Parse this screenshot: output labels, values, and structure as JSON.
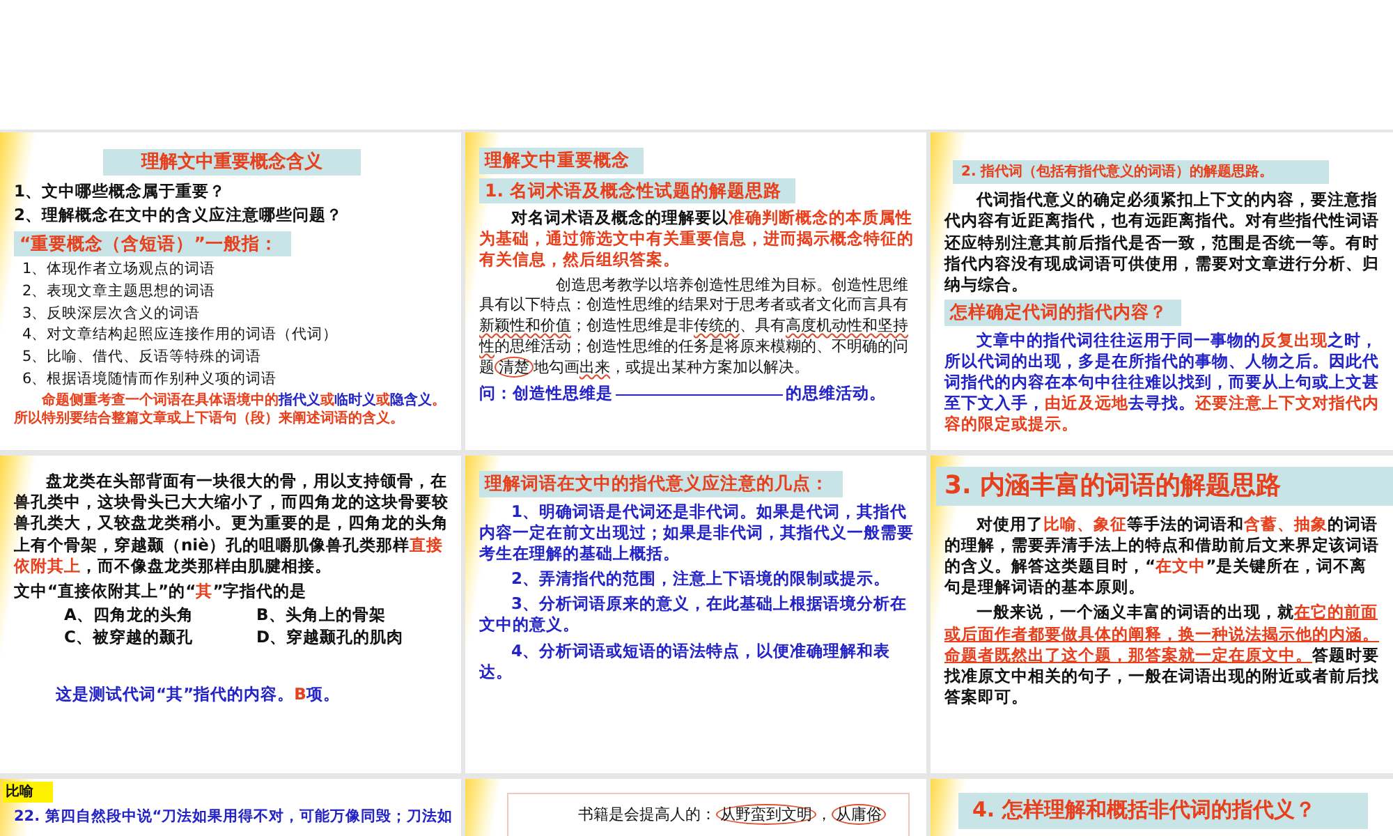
{
  "slides": [
    {
      "blocks": [
        {
          "kind": "title",
          "runs": [
            {
              "kind": "red",
              "text": "理解文中重要概念含义"
            }
          ]
        },
        {
          "kind": "line",
          "runs": [
            {
              "kind": "plain",
              "text": "1、文中哪些概念属于重要？"
            }
          ]
        },
        {
          "kind": "line",
          "runs": [
            {
              "kind": "plain",
              "text": "2、理解概念在文中的含义应注意哪些问题？"
            }
          ]
        },
        {
          "kind": "band",
          "runs": [
            {
              "kind": "red",
              "text": "“重要概念（含短语）”一般指："
            }
          ]
        },
        {
          "kind": "subline",
          "runs": [
            {
              "kind": "plain",
              "text": "1、体现作者立场观点的词语"
            }
          ]
        },
        {
          "kind": "subline",
          "runs": [
            {
              "kind": "plain",
              "text": "2、表现文章主题思想的词语"
            }
          ]
        },
        {
          "kind": "subline",
          "runs": [
            {
              "kind": "plain",
              "text": "3、反映深层次含义的词语"
            }
          ]
        },
        {
          "kind": "subline",
          "runs": [
            {
              "kind": "plain",
              "text": "4、对文章结构起照应连接作用的词语（代词）"
            }
          ]
        },
        {
          "kind": "subline",
          "runs": [
            {
              "kind": "plain",
              "text": "5、比喻、借代、反语等特殊的词语"
            }
          ]
        },
        {
          "kind": "subline",
          "runs": [
            {
              "kind": "plain",
              "text": "6、根据语境随情而作别种义项的词语"
            }
          ]
        },
        {
          "kind": "note",
          "runs": [
            {
              "kind": "red",
              "text": "命题侧重考查一个词语在具体语境中的"
            },
            {
              "kind": "blue",
              "text": "指代义"
            },
            {
              "kind": "red",
              "text": "或"
            },
            {
              "kind": "blue",
              "text": "临时义"
            },
            {
              "kind": "red",
              "text": "或"
            },
            {
              "kind": "blue",
              "text": "隐含义"
            },
            {
              "kind": "red",
              "text": "。所以特别要结合整篇文章或上下语句（段）来阐述词语的含义。"
            }
          ]
        }
      ]
    },
    {
      "blocks": [
        {
          "kind": "band",
          "runs": [
            {
              "kind": "red",
              "text": "理解文中重要概念"
            }
          ]
        },
        {
          "kind": "band",
          "runs": [
            {
              "kind": "red",
              "text": "1. 名词术语及概念性试题的解题思路"
            }
          ]
        },
        {
          "kind": "para",
          "runs": [
            {
              "kind": "plain",
              "text": "对名词术语及概念的理解要以"
            },
            {
              "kind": "red",
              "text": "准确判断概念的本质属性为基础，通过筛选文中有关重要信息，进而揭示概念特征的有关信息，然后组织答案。"
            }
          ]
        },
        {
          "kind": "quote",
          "runs": [
            {
              "kind": "plain",
              "text": "创造思考教学以培养创造性思维为目标。创造性思维具有以下特点：创造性思维的结果对于思考者或者文化而言具有"
            },
            {
              "kind": "marked",
              "text": "新颖性和价值"
            },
            {
              "kind": "plain",
              "text": "；创造性思维是非"
            },
            {
              "kind": "marked",
              "text": "传统的"
            },
            {
              "kind": "plain",
              "text": "、具有"
            },
            {
              "kind": "marked",
              "text": "高度机动性和坚持性"
            },
            {
              "kind": "plain",
              "text": "的思维活动；创造性思维的任务是将原来模糊的、不明确的问题"
            },
            {
              "kind": "circled",
              "text": "清楚"
            },
            {
              "kind": "plain",
              "text": "地勾画"
            },
            {
              "kind": "marked",
              "text": "出来"
            },
            {
              "kind": "plain",
              "text": "，或提出某种方案加以解决。"
            }
          ]
        },
        {
          "kind": "line",
          "runs": [
            {
              "kind": "blue",
              "text": "问：创造性思维是"
            },
            {
              "kind": "blank"
            },
            {
              "kind": "blue",
              "text": "的思维活动。"
            }
          ]
        }
      ]
    },
    {
      "blocks": [
        {
          "kind": "smallband",
          "runs": [
            {
              "kind": "red",
              "text": "2. 指代词（包括有指代意义的词语）的解题思路。"
            }
          ]
        },
        {
          "kind": "para",
          "runs": [
            {
              "kind": "plain",
              "text": "代词指代意义的确定必须紧扣上下文的内容，要注意指代内容有近距离指代，也有远距离指代。对有些指代性词语还应特别注意其前后指代是否一致，范围是否统一等。有时指代内容没有现成词语可供使用，需要对文章进行分析、归纳与综合。"
            }
          ]
        },
        {
          "kind": "band",
          "runs": [
            {
              "kind": "red",
              "text": "怎样确定代词的指代内容？"
            }
          ]
        },
        {
          "kind": "para",
          "runs": [
            {
              "kind": "blue",
              "text": "文章中的指代词往往运用于同一事物的"
            },
            {
              "kind": "red",
              "text": "反复出现"
            },
            {
              "kind": "blue",
              "text": "之时，所以代词的出现，多是在所指代的事物、人物之后。因此代词指代的内容在本句中往往难以找到，而要从上句或上文甚至下文入手，"
            },
            {
              "kind": "red",
              "text": "由近及远地"
            },
            {
              "kind": "blue",
              "text": "去寻找。"
            },
            {
              "kind": "red",
              "text": "还要注意上下文对指代内容的限定或提示。"
            }
          ]
        }
      ]
    },
    {
      "blocks": [
        {
          "kind": "para",
          "runs": [
            {
              "kind": "plain",
              "text": "盘龙类在头部背面有一块很大的骨，用以支持颌骨，在兽孔类中，这块骨头已大大缩小了，而四角龙的这块骨要较兽孔类大，又较盘龙类稍小。更为重要的是，四角龙的头角上有个骨架，穿越颞（niè）孔的咀嚼肌像兽孔类那样"
            },
            {
              "kind": "red",
              "text": "直接依附其上"
            },
            {
              "kind": "plain",
              "text": "，而不像盘龙类那样由肌腱相接。"
            }
          ]
        },
        {
          "kind": "line",
          "runs": [
            {
              "kind": "plain",
              "text": "文中“直接依附其上”的“"
            },
            {
              "kind": "red",
              "text": "其"
            },
            {
              "kind": "plain",
              "text": "”字指代的是"
            }
          ]
        },
        {
          "kind": "options",
          "options": [
            "A、四角龙的头角",
            "B、头角上的骨架"
          ]
        },
        {
          "kind": "options",
          "options": [
            "C、被穿越的颞孔",
            "D、穿越颞孔的肌肉"
          ]
        },
        {
          "kind": "answer",
          "runs": [
            {
              "kind": "blue",
              "text": "这是测试代词“其”指代的内容。"
            },
            {
              "kind": "red",
              "text": "B"
            },
            {
              "kind": "blue",
              "text": "项。"
            }
          ]
        }
      ]
    },
    {
      "blocks": [
        {
          "kind": "band",
          "runs": [
            {
              "kind": "red",
              "text": "理解词语在文中的指代意义应注意的几点："
            }
          ]
        },
        {
          "kind": "para",
          "runs": [
            {
              "kind": "blue",
              "text": "1、明确词语是代词还是非代词。如果是代词，其指代内容一定在前文出现过；如果是非代词，其指代义一般需要考生在理解的基础上概括。"
            }
          ]
        },
        {
          "kind": "para",
          "runs": [
            {
              "kind": "blue",
              "text": "2、弄清指代的范围，注意上下语境的限制或提示。"
            }
          ]
        },
        {
          "kind": "para",
          "runs": [
            {
              "kind": "blue",
              "text": "3、分析词语原来的意义，在此基础上根据语境分析在文中的意义。"
            }
          ]
        },
        {
          "kind": "para",
          "runs": [
            {
              "kind": "blue",
              "text": "4、分析词语或短语的语法特点，以便准确理解和表达。"
            }
          ]
        }
      ]
    },
    {
      "blocks": [
        {
          "kind": "bigband",
          "runs": [
            {
              "kind": "red",
              "text": "3. 内涵丰富的词语的解题思路"
            }
          ]
        },
        {
          "kind": "para",
          "runs": [
            {
              "kind": "plain",
              "text": "对使用了"
            },
            {
              "kind": "red",
              "text": "比喻、象征"
            },
            {
              "kind": "plain",
              "text": "等手法的词语和"
            },
            {
              "kind": "red",
              "text": "含蓄、抽象"
            },
            {
              "kind": "plain",
              "text": "的词语的理解，需要弄清手法上的特点和借助前后文来界定该词语的含义。解答这类题目时，“"
            },
            {
              "kind": "red",
              "text": "在文中"
            },
            {
              "kind": "plain",
              "text": "”是关键所在，词不离句是理解词语的基本原则。"
            }
          ]
        },
        {
          "kind": "para",
          "runs": [
            {
              "kind": "plain",
              "text": "一般来说，一个涵义丰富的词语的出现，就"
            },
            {
              "kind": "underlined",
              "text": "在它的前面或后面作者都要做具体的阐释，换一种说法揭示他的内涵。命题者既然出了这个题，那答案就一定在原文中。"
            },
            {
              "kind": "plain",
              "text": "答题时要找准原文中相关的句子，一般在词语出现的附近或者前后找答案即可。"
            }
          ]
        }
      ]
    },
    {
      "blocks": [
        {
          "kind": "tag",
          "runs": [
            {
              "kind": "plain",
              "text": "比喻"
            }
          ]
        },
        {
          "kind": "cutline",
          "runs": [
            {
              "kind": "blue",
              "text": "22. 第四自然段中说“刀法如果用得不对，可能万像同毁；刀法如"
            }
          ]
        }
      ]
    },
    {
      "blocks": [
        {
          "kind": "boxed",
          "runs": [
            {
              "kind": "plain",
              "text": "书籍是会提高人的："
            },
            {
              "kind": "circled",
              "text": "从野蛮到文明"
            },
            {
              "kind": "plain",
              "text": "，"
            },
            {
              "kind": "circled",
              "text": "从庸俗"
            }
          ]
        }
      ]
    },
    {
      "blocks": [
        {
          "kind": "wideband",
          "runs": [
            {
              "kind": "red",
              "text": "4. 怎样理解和概括非代词的指代义？"
            }
          ]
        }
      ]
    }
  ]
}
